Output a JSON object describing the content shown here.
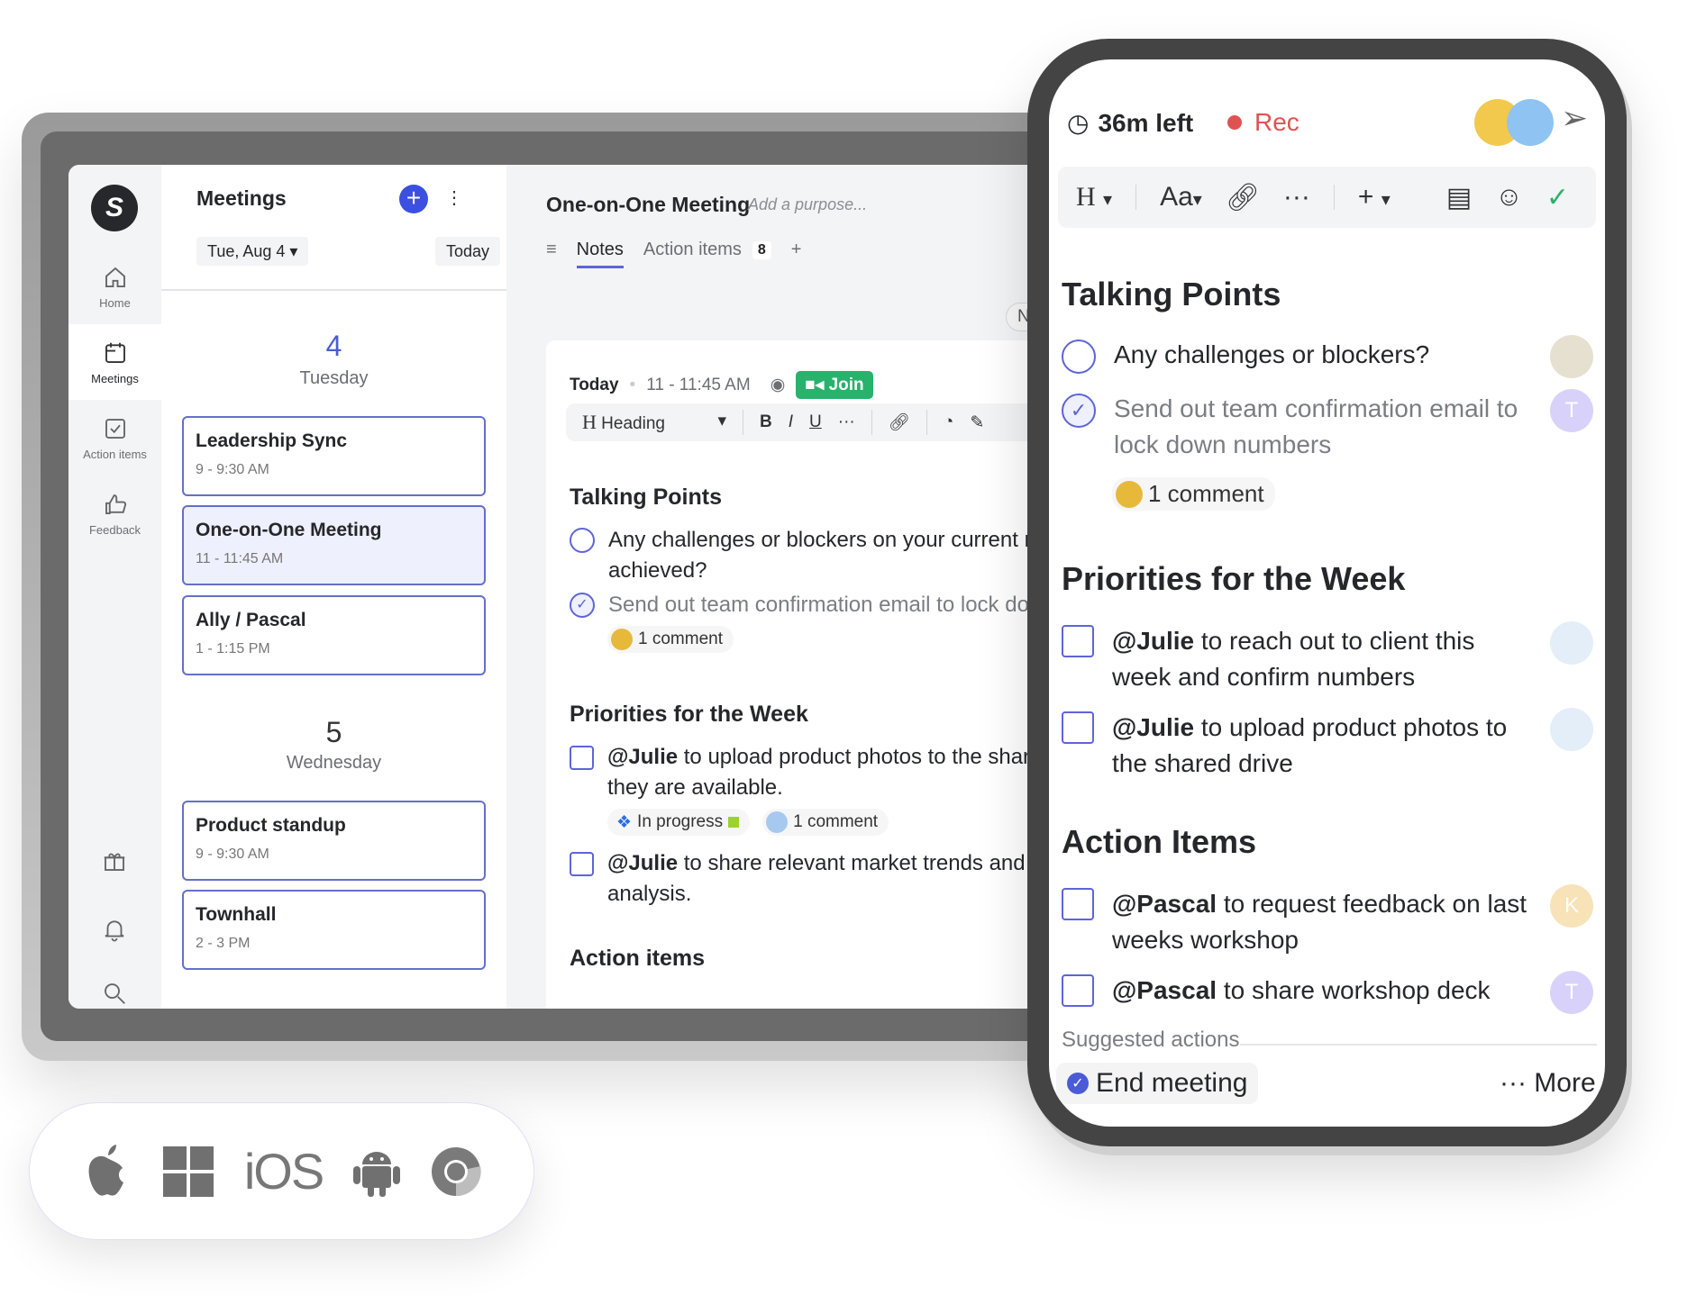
{
  "sidebar": {
    "logo": "S",
    "items": [
      {
        "label": "Home",
        "icon": "home-icon"
      },
      {
        "label": "Meetings",
        "icon": "calendar-icon",
        "active": true
      },
      {
        "label": "Action items",
        "icon": "checkbox-icon"
      },
      {
        "label": "Feedback",
        "icon": "thumbs-up-icon"
      }
    ],
    "bottom_icons": [
      "gift-icon",
      "bell-icon",
      "search-icon"
    ]
  },
  "meetings": {
    "title": "Meetings",
    "add": "+",
    "more": "⋮",
    "date": "Tue, Aug 4",
    "today": "Today",
    "days": [
      {
        "num": "4",
        "name": "Tuesday",
        "meetings": [
          {
            "title": "Leadership Sync",
            "time": "9 - 9:30 AM"
          },
          {
            "title": "One-on-One Meeting",
            "time": "11 - 11:45 AM",
            "selected": true
          },
          {
            "title": "Ally / Pascal",
            "time": "1 - 1:15 PM"
          }
        ]
      },
      {
        "num": "5",
        "name": "Wednesday",
        "meetings": [
          {
            "title": "Product standup",
            "time": "9 - 9:30 AM"
          },
          {
            "title": "Townhall",
            "time": "2 - 3 PM"
          }
        ]
      }
    ]
  },
  "main": {
    "title": "One-on-One Meeting",
    "purpose_placeholder": "Add a purpose...",
    "tabs": {
      "notes": "Notes",
      "action_items": "Action items",
      "action_count": "8",
      "add": "+"
    },
    "new_note": "New note",
    "note": {
      "day": "Today",
      "time": "11 - 11:45 AM",
      "join": "Join",
      "toolbar": {
        "style": "Heading",
        "heading_glyph": "H",
        "bold": "B",
        "italic": "I",
        "underline": "U",
        "more": "···"
      },
      "talking_points": "Talking Points",
      "tp1": "Any challenges or blockers on your current milestones achieved?",
      "tp2": "Send out team confirmation email to lock down numbers",
      "comment": "1 comment",
      "priorities": "Priorities for the Week",
      "mention": "@Julie",
      "p1": " to upload product photos to the shared drive when they are available.",
      "status": "In progress",
      "p2": " to share relevant market trends and competitor analysis.",
      "action_items": "Action items"
    }
  },
  "phone": {
    "time_left": "36m left",
    "rec": "Rec",
    "toolbar": {
      "h": "H",
      "aa": "Aa",
      "more": "···",
      "plus": "+"
    },
    "talking_points": "Talking Points",
    "tp1": "Any challenges or blockers?",
    "tp2": "Send out team confirmation email to lock down numbers",
    "comment": "1 comment",
    "priorities": "Priorities for the Week",
    "julie": "@Julie",
    "p1": " to reach out to client this week and confirm numbers",
    "p2": " to upload product photos to the shared drive",
    "action_items": "Action Items",
    "pascal": "@Pascal",
    "a1": " to request feedback on last weeks workshop",
    "a2": " to share workshop deck",
    "avatars": {
      "t": "T",
      "k": "K"
    },
    "suggested": "Suggested actions",
    "end_meeting": "End meeting",
    "more": "··· More"
  },
  "platforms": {
    "items": [
      "apple-icon",
      "windows-icon",
      "ios-icon",
      "android-icon",
      "chrome-icon"
    ],
    "ios_text": "iOS"
  },
  "colors": {
    "accent": "#5e64d8",
    "brand_blue": "#3b4fe0",
    "join_green": "#27b36b",
    "rec_red": "#e05252",
    "check_green": "#27b36b"
  }
}
